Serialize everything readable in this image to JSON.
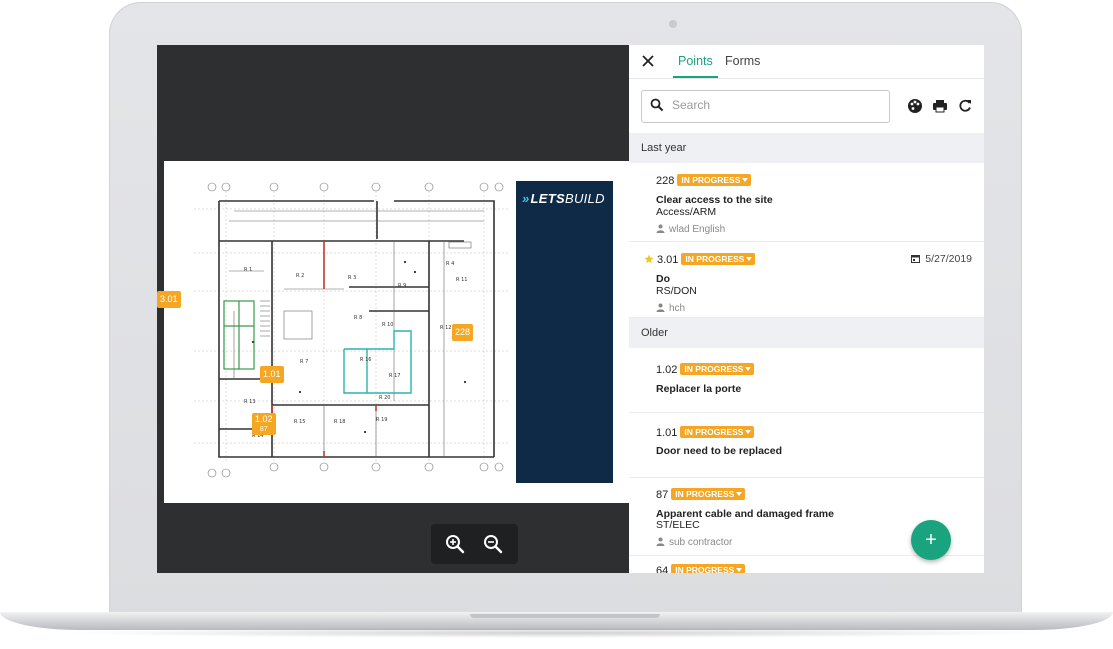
{
  "brand": {
    "logo_text_bold": "LETS",
    "logo_text_thin": "BUILD",
    "logo_mark": "»"
  },
  "plan": {
    "pins": [
      {
        "label": "3.01"
      },
      {
        "label": "228"
      },
      {
        "label": "1.01"
      },
      {
        "label": "1.02"
      },
      {
        "label": "87"
      }
    ],
    "rooms": [
      "R 1",
      "R 2",
      "R 3",
      "R 4",
      "R 7",
      "R 8",
      "R 9",
      "R 10",
      "R 11",
      "R 12",
      "R 13",
      "R 14",
      "R 15",
      "R 16",
      "R 17",
      "R 18",
      "R 19",
      "R 20"
    ]
  },
  "zoom": {
    "zoom_in_icon": "zoom-in-icon",
    "zoom_out_icon": "zoom-out-icon"
  },
  "panel": {
    "tabs": [
      {
        "label": "Points",
        "active": true
      },
      {
        "label": "Forms",
        "active": false
      }
    ],
    "search": {
      "placeholder": "Search",
      "value": ""
    },
    "tools": [
      "palette-icon",
      "print-icon",
      "refresh-icon"
    ],
    "groups": [
      {
        "label": "Last year",
        "items": [
          {
            "number": "228",
            "status": "IN PROGRESS",
            "title": "Clear access to the site",
            "subtitle": "Access/ARM",
            "user": "wlad English",
            "date": "",
            "starred": false
          },
          {
            "number": "3.01",
            "status": "IN PROGRESS",
            "title": "Do",
            "subtitle": "RS/DON",
            "user": "hch",
            "date": "5/27/2019",
            "starred": true
          }
        ]
      },
      {
        "label": "Older",
        "items": [
          {
            "number": "1.02",
            "status": "IN PROGRESS",
            "title": "Replacer la porte",
            "subtitle": "",
            "user": "",
            "date": "",
            "starred": false
          },
          {
            "number": "1.01",
            "status": "IN PROGRESS",
            "title": "Door need to be replaced",
            "subtitle": "",
            "user": "",
            "date": "",
            "starred": false
          },
          {
            "number": "87",
            "status": "IN PROGRESS",
            "title": "Apparent cable and damaged frame",
            "subtitle": "ST/ELEC",
            "user": "sub contractor",
            "date": "",
            "starred": false
          },
          {
            "number": "64",
            "status": "IN PROGRESS",
            "title": "",
            "subtitle": "",
            "user": "",
            "date": "",
            "starred": false
          }
        ]
      }
    ],
    "fab_label": "+"
  },
  "colors": {
    "accent": "#1aa37f",
    "status_in_progress": "#f5a623",
    "brand_navy": "#0e2a46",
    "viewer_bg": "#2e2f31"
  }
}
